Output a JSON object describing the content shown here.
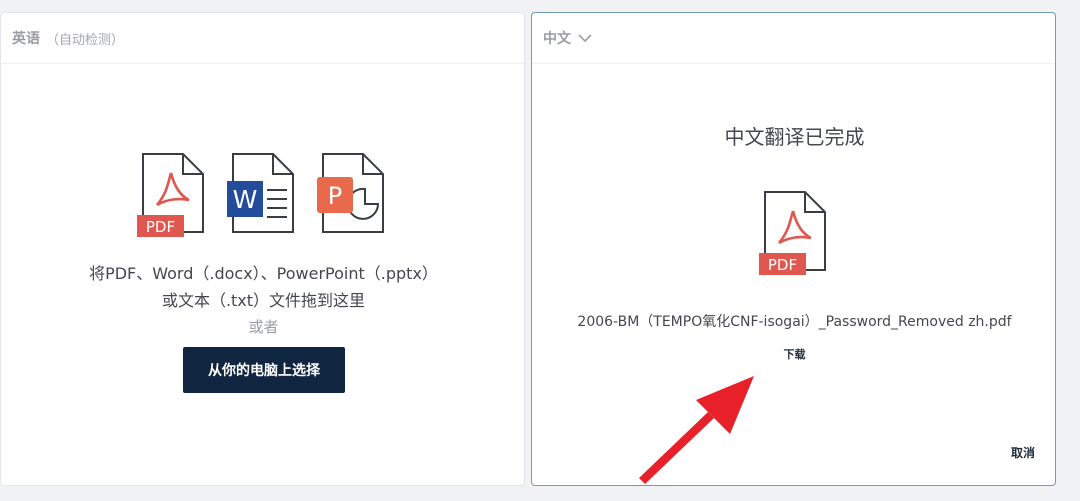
{
  "source_panel": {
    "language": "英语",
    "detect_label": "（自动检测）",
    "drop_text_line1": "将PDF、Word（.docx）、PowerPoint（.pptx）",
    "drop_text_line2": "或文本（.txt）文件拖到这里",
    "or_label": "或者",
    "choose_button": "从你的电脑上选择",
    "file_icons": [
      {
        "name": "pdf-file-icon",
        "badge": "PDF",
        "color": "#e0574f"
      },
      {
        "name": "word-file-icon",
        "badge": "W",
        "color": "#234c9a"
      },
      {
        "name": "powerpoint-file-icon",
        "badge": "P",
        "color": "#e9694c"
      }
    ]
  },
  "target_panel": {
    "language": "中文",
    "dropdown_icon": "chevron-down-icon",
    "status_title": "中文翻译已完成",
    "result_badge": "PDF",
    "result_filename": "2006-BM（TEMPO氧化CNF-isogai）_Password_Removed zh.pdf",
    "download_label": "下载",
    "cancel_label": "取消"
  },
  "colors": {
    "dark_button": "#0f2540",
    "pdf_red": "#e0574f",
    "word_blue": "#234c9a",
    "ppt_orange": "#e9694c",
    "annotation_arrow": "#e8202a"
  }
}
